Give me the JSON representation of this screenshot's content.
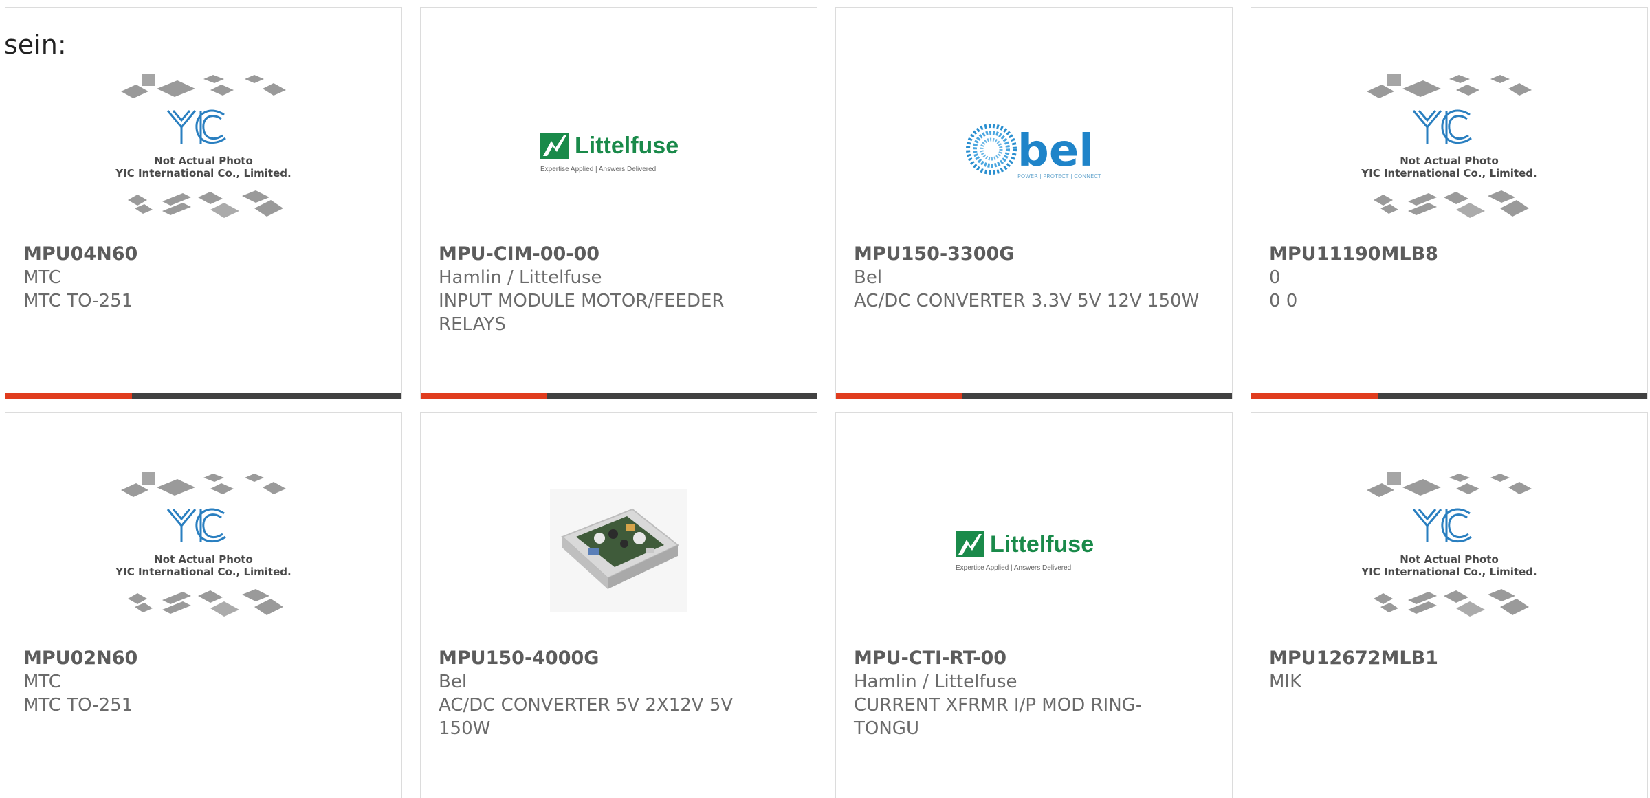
{
  "lead_text": "sein:",
  "placeholder": {
    "logo_text": "YIC",
    "line1": "Not Actual Photo",
    "line2": "YIC International Co., Limited."
  },
  "brand_logos": {
    "littelfuse": {
      "name": "Littelfuse",
      "tagline": "Expertise Applied | Answers Delivered"
    },
    "bel": {
      "name": "bel",
      "tagline": "POWER | PROTECT | CONNECT"
    }
  },
  "colors": {
    "accent": "#e03c1e",
    "bar": "#414141",
    "littelfuse_green": "#1a8a4a",
    "bel_blue": "#1f84c9",
    "yic_blue": "#2a7fc0"
  },
  "products": [
    {
      "part": "MPU04N60",
      "maker": "MTC",
      "desc": "MTC TO-251",
      "image": "yic-placeholder",
      "progress": 0.32
    },
    {
      "part": "MPU-CIM-00-00",
      "maker": "Hamlin / Littelfuse",
      "desc": "INPUT MODULE MOTOR/FEEDER RELAYS",
      "image": "littelfuse-logo",
      "progress": 0.32
    },
    {
      "part": "MPU150-3300G",
      "maker": "Bel",
      "desc": "AC/DC CONVERTER 3.3V 5V 12V 150W",
      "image": "bel-logo",
      "progress": 0.32
    },
    {
      "part": "MPU11190MLB8",
      "maker": "0",
      "desc": "0 0",
      "image": "yic-placeholder",
      "progress": 0.32
    },
    {
      "part": "MPU02N60",
      "maker": "MTC",
      "desc": "MTC TO-251",
      "image": "yic-placeholder"
    },
    {
      "part": "MPU150-4000G",
      "maker": "Bel",
      "desc": "AC/DC CONVERTER 5V 2X12V 5V 150W",
      "image": "power-supply-photo"
    },
    {
      "part": "MPU-CTI-RT-00",
      "maker": "Hamlin / Littelfuse",
      "desc": "CURRENT XFRMR I/P MOD RING-TONGU",
      "image": "littelfuse-logo"
    },
    {
      "part": "MPU12672MLB1",
      "maker": "MIK",
      "desc": "",
      "image": "yic-placeholder"
    }
  ]
}
